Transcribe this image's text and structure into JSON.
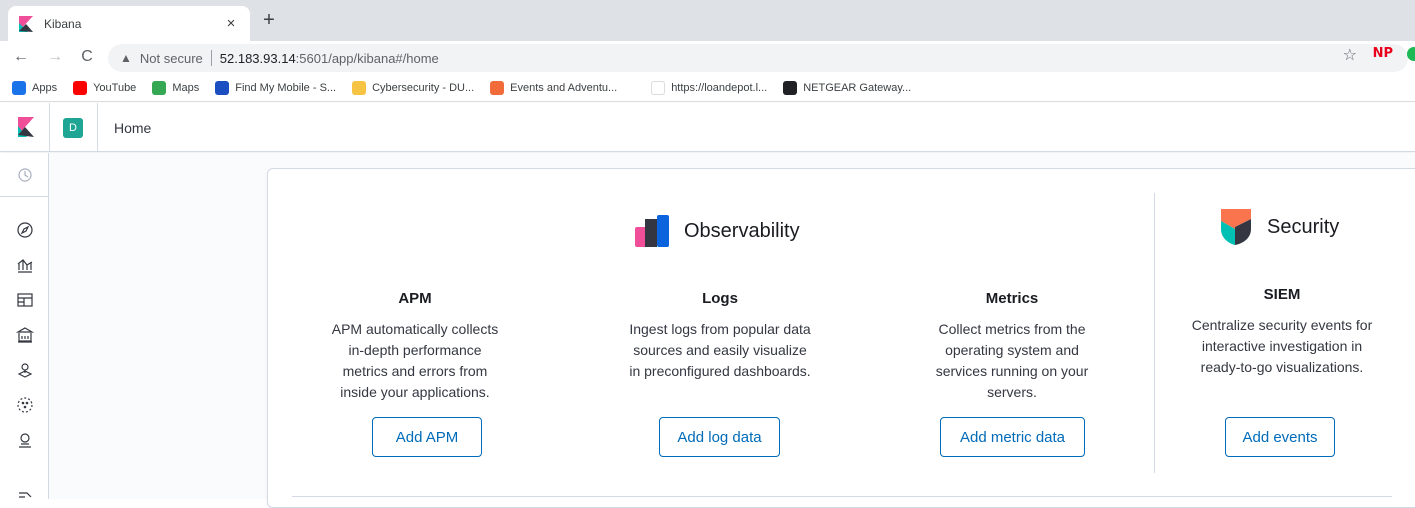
{
  "browser": {
    "tab_title": "Kibana",
    "tab_close": "×",
    "new_tab": "+",
    "back": "←",
    "forward": "→",
    "reload": "C",
    "not_secure": "Not secure",
    "url_host": "52.183.93.14",
    "url_path": ":5601/app/kibana#/home",
    "star": "☆",
    "ext_np": "NP",
    "bookmarks": [
      {
        "label": "Apps",
        "icon": "apps-grid-icon",
        "color": "#1a73e8"
      },
      {
        "label": "YouTube",
        "icon": "youtube-icon",
        "color": "#ff0000"
      },
      {
        "label": "Maps",
        "icon": "maps-pin-icon",
        "color": "#34a853"
      },
      {
        "label": "Find My Mobile - S...",
        "icon": "find-my-mobile-icon",
        "color": "#1a4ec1"
      },
      {
        "label": "Cybersecurity - DU...",
        "icon": "folder-icon",
        "color": "#f6c342"
      },
      {
        "label": "Events and Adventu...",
        "icon": "events-icon",
        "color": "#f26b3a"
      },
      {
        "label": "https://loandepot.l...",
        "icon": "blank-page-icon",
        "color": "#ffffff"
      },
      {
        "label": "NETGEAR Gateway...",
        "icon": "tools-icon",
        "color": "#202124"
      }
    ]
  },
  "kibana": {
    "space_initial": "D",
    "breadcrumb": "Home"
  },
  "observability": {
    "title": "Observability",
    "cards": [
      {
        "title": "APM",
        "description": [
          "APM automatically collects",
          "in-depth performance",
          "metrics and errors from",
          "inside your applications."
        ],
        "button": "Add APM"
      },
      {
        "title": "Logs",
        "description": [
          "Ingest logs from popular data",
          "sources and easily visualize",
          "in preconfigured dashboards."
        ],
        "button": "Add log data"
      },
      {
        "title": "Metrics",
        "description": [
          "Collect metrics from the",
          "operating system and",
          "services running on your",
          "servers."
        ],
        "button": "Add metric data"
      }
    ]
  },
  "security": {
    "title": "Security",
    "cards": [
      {
        "title": "SIEM",
        "description": [
          "Centralize security events for",
          "interactive investigation in",
          "ready-to-go visualizations."
        ],
        "button": "Add events"
      }
    ]
  },
  "colors": {
    "accent": "#006bb8",
    "space_avatar": "#1ea593"
  }
}
